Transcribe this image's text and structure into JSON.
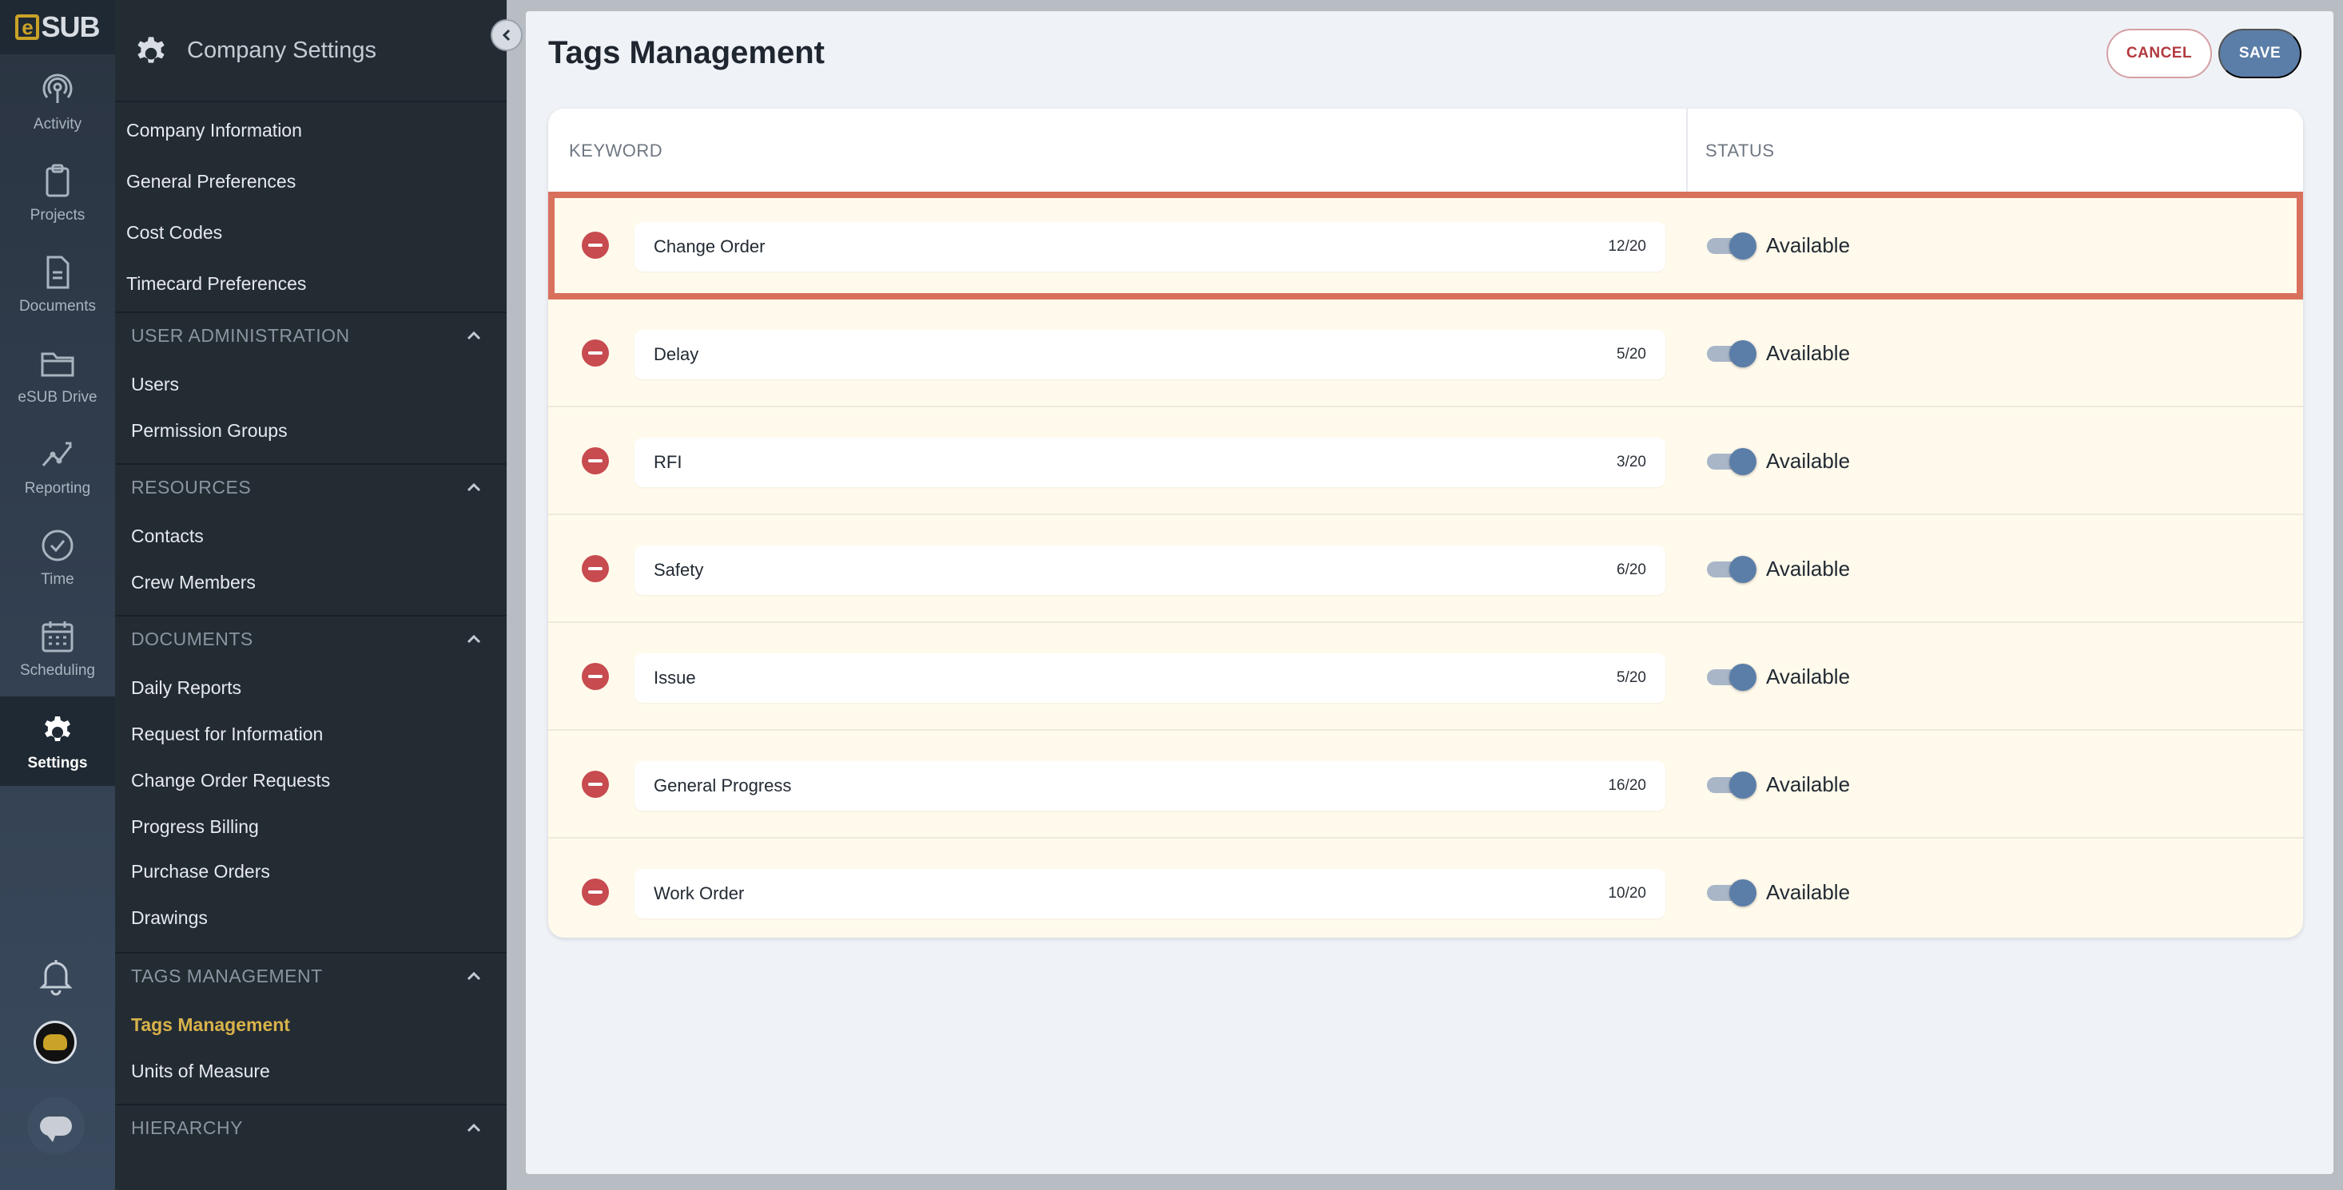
{
  "brand": {
    "logo_letter": "e",
    "logo_text": "SUB",
    "accent": "#c9a227"
  },
  "rail": {
    "items": [
      {
        "label": "Activity",
        "icon": "activity-icon"
      },
      {
        "label": "Projects",
        "icon": "clipboard-icon"
      },
      {
        "label": "Documents",
        "icon": "document-icon"
      },
      {
        "label": "eSUB Drive",
        "icon": "folder-icon"
      },
      {
        "label": "Reporting",
        "icon": "chart-icon"
      },
      {
        "label": "Time",
        "icon": "clock-icon"
      },
      {
        "label": "Scheduling",
        "icon": "calendar-icon"
      },
      {
        "label": "Settings",
        "icon": "gear-icon",
        "active": true
      }
    ]
  },
  "sidebar": {
    "title": "Company Settings",
    "top_links": [
      "Company Information",
      "General Preferences",
      "Cost Codes",
      "Timecard Preferences"
    ],
    "sections": [
      {
        "label": "USER ADMINISTRATION",
        "items": [
          "Users",
          "Permission Groups"
        ]
      },
      {
        "label": "RESOURCES",
        "items": [
          "Contacts",
          "Crew Members"
        ]
      },
      {
        "label": "DOCUMENTS",
        "items": [
          "Daily Reports",
          "Request for Information",
          "Change Order Requests",
          "Progress Billing",
          "Purchase Orders",
          "Drawings"
        ]
      },
      {
        "label": "TAGS MANAGEMENT",
        "items": [
          "Tags Management",
          "Units of Measure"
        ],
        "active_item": "Tags Management"
      },
      {
        "label": "HIERARCHY",
        "items": []
      }
    ]
  },
  "main": {
    "title": "Tags Management",
    "cancel_label": "CANCEL",
    "save_label": "SAVE",
    "columns": {
      "keyword": "KEYWORD",
      "status": "STATUS"
    },
    "rows": [
      {
        "keyword": "Change Order",
        "count": "12/20",
        "status": "Available",
        "highlighted": true
      },
      {
        "keyword": "Delay",
        "count": "5/20",
        "status": "Available"
      },
      {
        "keyword": "RFI",
        "count": "3/20",
        "status": "Available"
      },
      {
        "keyword": "Safety",
        "count": "6/20",
        "status": "Available"
      },
      {
        "keyword": "Issue",
        "count": "5/20",
        "status": "Available"
      },
      {
        "keyword": "General Progress",
        "count": "16/20",
        "status": "Available"
      },
      {
        "keyword": "Work Order",
        "count": "10/20",
        "status": "Available"
      }
    ]
  }
}
